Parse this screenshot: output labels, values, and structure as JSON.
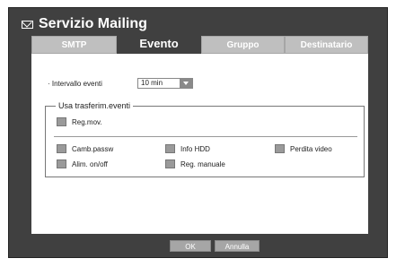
{
  "window": {
    "title": "Servizio Mailing"
  },
  "tabs": [
    {
      "label": "SMTP"
    },
    {
      "label": "Evento"
    },
    {
      "label": "Gruppo"
    },
    {
      "label": "Destinatario"
    }
  ],
  "interval": {
    "label": "· Intervallo eventi",
    "value": "10 min"
  },
  "group": {
    "title": "Usa trasferim.eventi",
    "items": [
      {
        "label": "Reg.mov.",
        "checked": false
      },
      {
        "label": "Camb.passw",
        "checked": false
      },
      {
        "label": "Info HDD",
        "checked": false
      },
      {
        "label": "Perdita video",
        "checked": false
      },
      {
        "label": "Alim. on/off",
        "checked": false
      },
      {
        "label": "Reg. manuale",
        "checked": false
      }
    ]
  },
  "buttons": {
    "ok": "OK",
    "cancel": "Annulla"
  }
}
